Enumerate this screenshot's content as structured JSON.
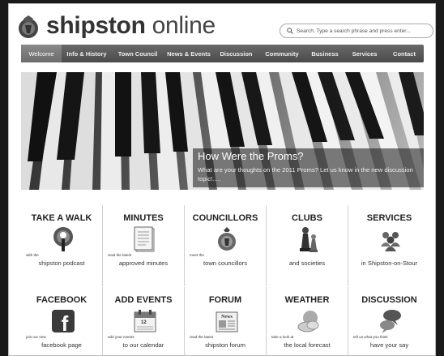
{
  "site": {
    "brand_bold": "shipston",
    "brand_light": " online"
  },
  "search": {
    "placeholder": "Search: Type a search phrase and press enter..."
  },
  "nav": {
    "items": [
      {
        "label": "Welcome",
        "active": true
      },
      {
        "label": "Info & History"
      },
      {
        "label": "Town Council"
      },
      {
        "label": "News & Events"
      },
      {
        "label": "Discussion"
      },
      {
        "label": "Community"
      },
      {
        "label": "Business"
      },
      {
        "label": "Services"
      },
      {
        "label": "Contact"
      }
    ]
  },
  "hero": {
    "title": "How Were the Proms?",
    "subtitle": "What are your thoughts on the 2011 Proms?  Let us know in the new discussion topic!....."
  },
  "tiles": [
    {
      "title": "TAKE A WALK",
      "icon": "podcast-icon",
      "small": "with the",
      "big": "shipston podcast"
    },
    {
      "title": "MINUTES",
      "icon": "document-icon",
      "small": "read the latest",
      "big": "approved minutes"
    },
    {
      "title": "COUNCILLORS",
      "icon": "crest-icon",
      "small": "meet the",
      "big": "town councillors"
    },
    {
      "title": "CLUBS",
      "icon": "chess-icon",
      "small": "",
      "big": "and societies"
    },
    {
      "title": "SERVICES",
      "icon": "people-icon",
      "small": "",
      "big": "in Shipston-on-Stour"
    },
    {
      "title": "FACEBOOK",
      "icon": "facebook-icon",
      "small": "join our new",
      "big": "facebook page"
    },
    {
      "title": "ADD EVENTS",
      "icon": "calendar-icon",
      "small": "add your events",
      "big": "to our calendar"
    },
    {
      "title": "FORUM",
      "icon": "newspaper-icon",
      "small": "read the latest",
      "big": "shipston forum"
    },
    {
      "title": "WEATHER",
      "icon": "weather-icon",
      "small": "take a look at",
      "big": "the local forecast"
    },
    {
      "title": "DISCUSSION",
      "icon": "speech-bubbles-icon",
      "small": "tell us what you think",
      "big": "have your say"
    }
  ],
  "calendar": {
    "day": "12"
  },
  "facebook": {
    "glyph": "f"
  },
  "forum": {
    "masthead": "News"
  }
}
